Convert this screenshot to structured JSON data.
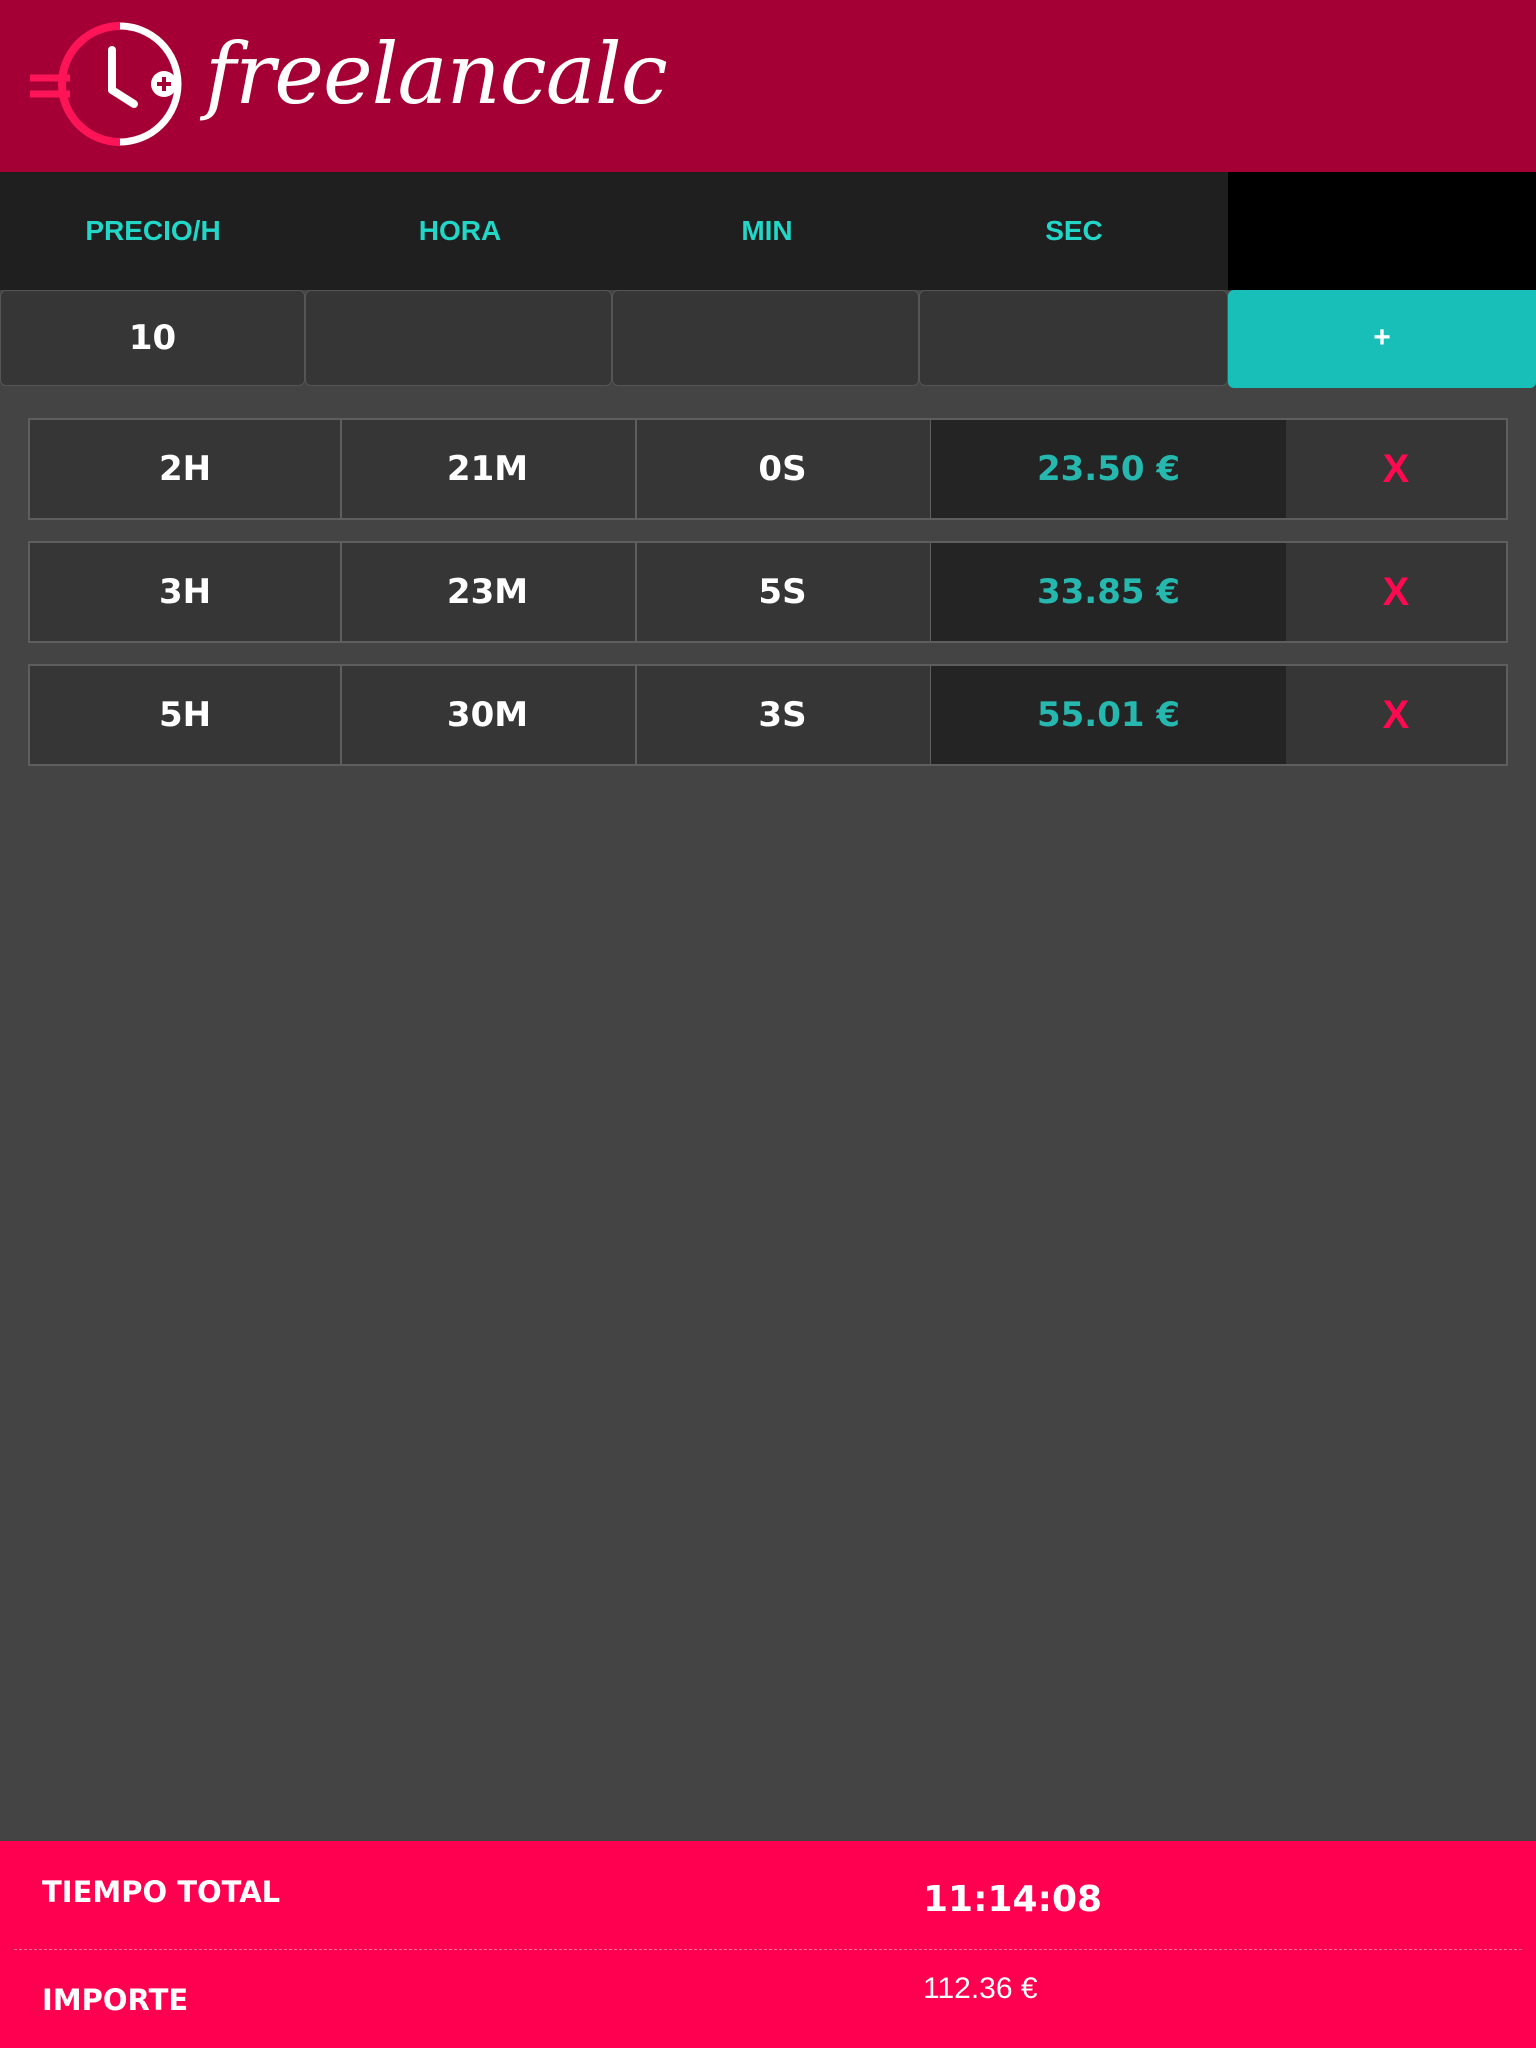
{
  "header": {
    "app_name": "freelancalc"
  },
  "column_labels": [
    "PRECIO/H",
    "HORA",
    "MIN",
    "SEC"
  ],
  "inputs": {
    "price": "10",
    "hour": "",
    "min": "",
    "sec": ""
  },
  "add_button": "+",
  "entries": [
    {
      "hours": "2H",
      "minutes": "21M",
      "seconds": "0S",
      "amount": "23.50 €",
      "delete": "X"
    },
    {
      "hours": "3H",
      "minutes": "23M",
      "seconds": "5S",
      "amount": "33.85 €",
      "delete": "X"
    },
    {
      "hours": "5H",
      "minutes": "30M",
      "seconds": "3S",
      "amount": "55.01 €",
      "delete": "X"
    }
  ],
  "footer": {
    "total_time_label": "TIEMPO TOTAL",
    "total_time": "11:14:08",
    "amount_label": "IMPORTE",
    "amount": "112.36 €"
  },
  "colors": {
    "header": "#a40035",
    "accent": "#18bfb8",
    "danger": "#ff0050"
  },
  "icons": {
    "logo": "euro-clock-plus-icon"
  }
}
